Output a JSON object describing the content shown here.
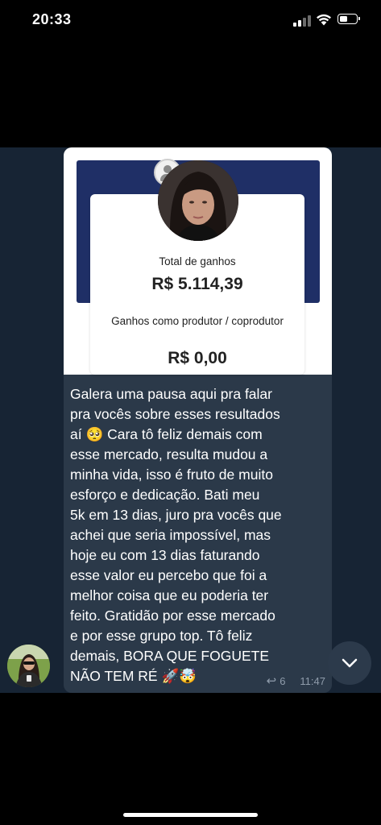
{
  "status_bar": {
    "time": "20:33"
  },
  "post": {
    "screenshot": {
      "total_label": "Total de ganhos",
      "total_value": "R$ 5.114,39",
      "producer_label": "Ganhos como produtor / coprodutor",
      "producer_value": "R$ 0,00"
    },
    "message": "Galera uma pausa aqui pra falar\npra vocês sobre esses resultados\naí 🥺 Cara tô feliz demais com\nesse mercado, resulta mudou a\nminha vida, isso é fruto de muito\nesforço e dedicação. Bati meu\n5k em 13 dias, juro pra vocês que\nachei que seria impossível, mas\nhoje eu com 13 dias faturando\nesse valor eu percebo que foi a\nmelhor coisa que eu poderia ter\nfeito. Gratidão por esse mercado\ne por esse grupo top. Tô feliz\ndemais, BORA QUE FOGUETE\nNÃO TEM RÉ 🚀🤯",
    "reply_count": "6",
    "time": "11:47"
  },
  "icons": {
    "signal": "signal-icon",
    "wifi": "wifi-icon",
    "battery": "battery-icon",
    "reply": "reply-arrow-icon",
    "scroll_down": "chevron-down-icon"
  },
  "colors": {
    "chat_background": "#172434",
    "bubble": "#2b3949",
    "card_header": "#1f2f66",
    "meta_text": "#8f9cab"
  }
}
